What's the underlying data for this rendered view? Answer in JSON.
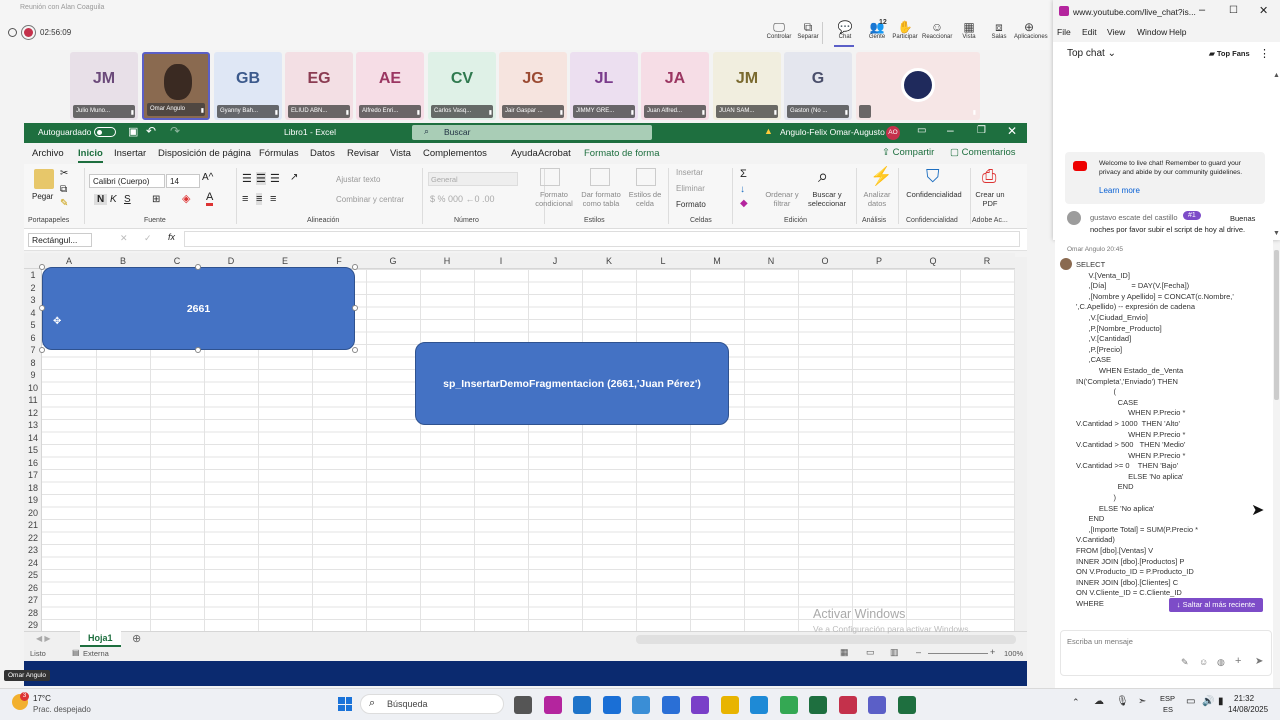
{
  "teams": {
    "meeting_title": "Reunión con Alan Coaguila",
    "timer": "02:56:09",
    "toolbar": [
      {
        "label": "Controlar",
        "icon": "screen-share-icon"
      },
      {
        "label": "Separar",
        "icon": "pop-out-icon"
      },
      {
        "label": "Chat",
        "icon": "chat-icon"
      },
      {
        "label": "Gente",
        "icon": "people-icon",
        "count": "12"
      },
      {
        "label": "Participar",
        "icon": "raise-hand-icon"
      },
      {
        "label": "Reaccionar",
        "icon": "emoji-icon"
      },
      {
        "label": "Vista",
        "icon": "grid-view-icon"
      },
      {
        "label": "Salas",
        "icon": "rooms-icon"
      },
      {
        "label": "Aplicaciones",
        "icon": "apps-plus-icon"
      }
    ],
    "participants": [
      {
        "initials": "JM",
        "name": "Julio Muno...",
        "bg": "#e8e0e8",
        "fg": "#6b4a7a"
      },
      {
        "initials": "",
        "name": "Omar Angulo",
        "bg": "#8a6a50",
        "fg": "#fff"
      },
      {
        "initials": "GB",
        "name": "Gyanny Bah...",
        "bg": "#dfe7f5",
        "fg": "#3c5a8c"
      },
      {
        "initials": "EG",
        "name": "ELIUD ABN...",
        "bg": "#f3dfe4",
        "fg": "#8b3c52"
      },
      {
        "initials": "AE",
        "name": "Alfredo Enri...",
        "bg": "#f6dde6",
        "fg": "#9b3662"
      },
      {
        "initials": "CV",
        "name": "Carlos Vasq...",
        "bg": "#dff1e7",
        "fg": "#2f7a4f"
      },
      {
        "initials": "JG",
        "name": "Jair Gaspar ...",
        "bg": "#f6e4df",
        "fg": "#9b4a32"
      },
      {
        "initials": "JL",
        "name": "JIMMY GRE...",
        "bg": "#ecdff0",
        "fg": "#7a3c8c"
      },
      {
        "initials": "JA",
        "name": "Juan Alfred...",
        "bg": "#f6dde6",
        "fg": "#9b3662"
      },
      {
        "initials": "JM",
        "name": "JUAN SAM...",
        "bg": "#f1eedf",
        "fg": "#7a6a2f"
      },
      {
        "initials": "G",
        "name": "Gaston (No ...",
        "bg": "#e4e6ee",
        "fg": "#4a4f6b"
      },
      {
        "initials": "",
        "name": "",
        "bg": "#f6e6e6",
        "fg": "#fff"
      }
    ],
    "presenter_tag": "Omar Angulo"
  },
  "excel": {
    "autosave": "Autoguardado",
    "file": "Libro1",
    "sep": "-",
    "app": "Excel",
    "search_placeholder": "Buscar",
    "user": "Angulo-Felix Omar-Augusto",
    "user_initials": "AO",
    "menu": [
      "Archivo",
      "Inicio",
      "Insertar",
      "Disposición de página",
      "Fórmulas",
      "Datos",
      "Revisar",
      "Vista",
      "Complementos",
      "Ayuda",
      "Acrobat",
      "Formato de forma"
    ],
    "share": "Compartir",
    "comments": "Comentarios",
    "ribbon": {
      "paste": "Pegar",
      "font": "Calibri (Cuerpo)",
      "size": "14",
      "wrap": "Ajustar texto",
      "merge": "Combinar y centrar",
      "num_format": "General",
      "cond": "Formato condicional",
      "table": "Dar formato como tabla",
      "styles_lbl": "Estilos de celda",
      "insert": "Insertar",
      "delete": "Eliminar",
      "format": "Formato",
      "sort": "Ordenar y filtrar",
      "find": "Buscar y seleccionar",
      "analyze": "Analizar datos",
      "conf": "Confidencialidad",
      "pdf": "Crear un PDF",
      "groups": [
        "Portapapeles",
        "Fuente",
        "Alineación",
        "Número",
        "Estilos",
        "Celdas",
        "Edición",
        "Análisis",
        "Confidencialidad",
        "Adobe Ac..."
      ]
    },
    "namebox": "Rectángul...",
    "fx": "fx",
    "columns": [
      "A",
      "B",
      "C",
      "D",
      "E",
      "F",
      "G",
      "H",
      "I",
      "J",
      "K",
      "L",
      "M",
      "N",
      "O",
      "P",
      "Q",
      "R"
    ],
    "rows": [
      "1",
      "2",
      "3",
      "4",
      "5",
      "6",
      "7",
      "8",
      "9",
      "10",
      "11",
      "12",
      "13",
      "14",
      "15",
      "16",
      "17",
      "18",
      "19",
      "20",
      "21",
      "22",
      "23",
      "24",
      "25",
      "26",
      "27",
      "28",
      "29"
    ],
    "shape1": "2661",
    "shape2": "sp_InsertarDemoFragmentacion (2661,'Juan Pérez')",
    "sheet": "Hoja1",
    "status": "Listo",
    "accessibility": "Externa",
    "zoom": "100%",
    "watermark": "Activar Windows",
    "watermark_sub": "Ve a Configuración para activar Windows."
  },
  "youtube": {
    "url": "www.youtube.com/live_chat?is...",
    "menu": [
      "File",
      "Edit",
      "View",
      "Window",
      "Help"
    ],
    "top_chat": "Top chat",
    "top_fans": "Top Fans",
    "welcome": "Welcome to live chat! Remember to guard your privacy and abide by our community guidelines.",
    "learn": "Learn more",
    "msg_author": "gustavo escate del castillo",
    "msg_badge": "#1",
    "msg_text": "Buenas noches por favor subir el script de hoy al drive."
  },
  "chat": {
    "author": "Omar Angulo",
    "time": "20:45",
    "code": "SELECT\n      V.[Venta_ID]\n      ,[Día]            = DAY(V.[Fecha])\n      ,[Nombre y Apellido] = CONCAT(c.Nombre,'\n',C.Apellido) -- expresión de cadena\n      ,V.[Ciudad_Envio]\n      ,P.[Nombre_Producto]\n      ,V.[Cantidad]\n      ,P.[Precio]\n      ,CASE\n           WHEN Estado_de_Venta\nIN('Completa','Enviado') THEN\n                  (\n                    CASE\n                         WHEN P.Precio *\nV.Cantidad > 1000  THEN 'Alto'\n                         WHEN P.Precio *\nV.Cantidad > 500   THEN 'Medio'\n                         WHEN P.Precio *\nV.Cantidad >= 0    THEN 'Bajo'\n                         ELSE 'No aplica'\n                    END\n                  )\n           ELSE 'No aplica'\n      END\n      ,[Importe Total] = SUM(P.Precio *\nV.Cantidad)\nFROM [dbo].[Ventas] V\nINNER JOIN [dbo].[Productos] P\nON V.Producto_ID = P.Producto_ID\nINNER JOIN [dbo].[Clientes] C\nON V.Cliente_ID = C.Cliente_ID\nWHERE",
    "jump": "Saltar al más reciente",
    "placeholder": "Escriba un mensaje"
  },
  "taskbar": {
    "temp": "17°C",
    "weather": "Prac. despejado",
    "search": "Búsqueda",
    "lang1": "ESP",
    "lang2": "ES",
    "time": "21:32",
    "date": "14/08/2025"
  }
}
